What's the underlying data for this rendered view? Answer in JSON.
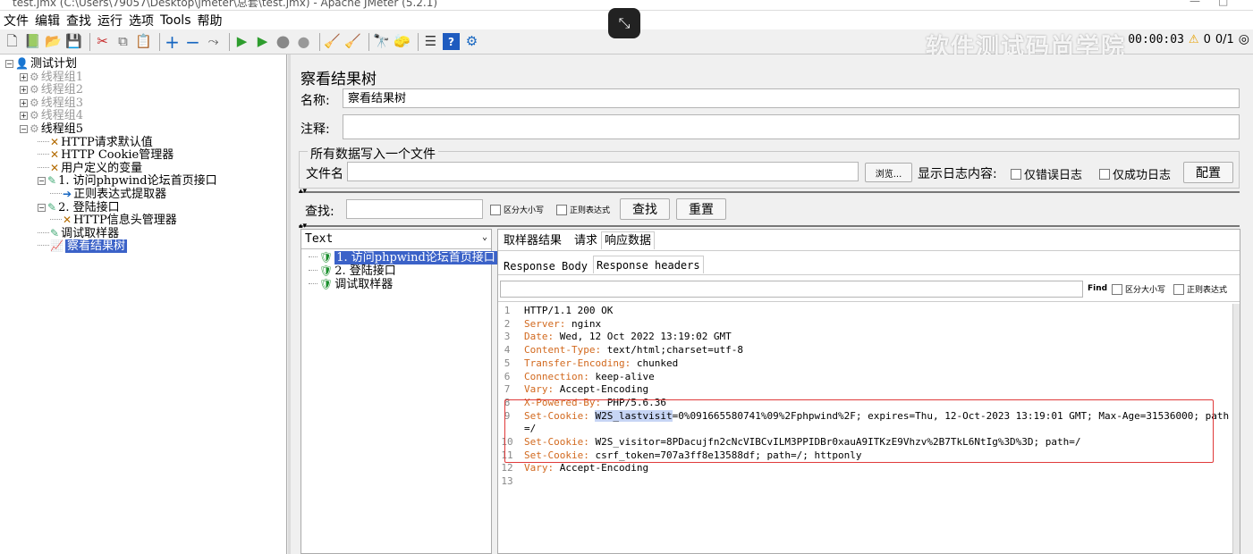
{
  "window": {
    "title": "test.jmx (C:\\Users\\79057\\Desktop\\jmeter\\总套\\test.jmx) - Apache JMeter (5.2.1)"
  },
  "menu": [
    "文件",
    "编辑",
    "查找",
    "运行",
    "选项",
    "Tools",
    "帮助"
  ],
  "toolbar": {
    "icons": [
      "new-icon",
      "templates-icon",
      "open-icon",
      "save-icon",
      "cut-icon",
      "copy-icon",
      "paste-icon",
      "expand-icon",
      "collapse-icon",
      "toggle-icon",
      "start-icon",
      "start-no-pause-icon",
      "stop-icon",
      "shutdown-icon",
      "clear-icon",
      "clear-all-icon",
      "search-icon",
      "reset-search-icon",
      "function-helper-icon",
      "help-icon",
      "remote-icon"
    ],
    "timer": "00:00:03",
    "warning_count": "0",
    "threads": "0/1"
  },
  "watermark": "软件测试码尚学院",
  "tree": [
    {
      "label": "测试计划",
      "level": 0,
      "icon": "test-plan-icon",
      "expand": "⊟"
    },
    {
      "label": "线程组1",
      "level": 1,
      "icon": "thread-group-icon",
      "expand": "⊞",
      "disabled": true
    },
    {
      "label": "线程组2",
      "level": 1,
      "icon": "thread-group-icon",
      "expand": "⊞",
      "disabled": true
    },
    {
      "label": "线程组3",
      "level": 1,
      "icon": "thread-group-icon",
      "expand": "⊞",
      "disabled": true
    },
    {
      "label": "线程组4",
      "level": 1,
      "icon": "thread-group-icon",
      "expand": "⊞",
      "disabled": true
    },
    {
      "label": "线程组5",
      "level": 1,
      "icon": "thread-group-icon",
      "expand": "⊟"
    },
    {
      "label": "HTTP请求默认值",
      "level": 2,
      "icon": "config-icon"
    },
    {
      "label": "HTTP Cookie管理器",
      "level": 2,
      "icon": "config-icon"
    },
    {
      "label": "用户定义的变量",
      "level": 2,
      "icon": "config-icon"
    },
    {
      "label": "1. 访问phpwind论坛首页接口",
      "level": 2,
      "icon": "sampler-icon",
      "expand": "⊟"
    },
    {
      "label": "正则表达式提取器",
      "level": 3,
      "icon": "extractor-icon"
    },
    {
      "label": "2. 登陆接口",
      "level": 2,
      "icon": "sampler-icon",
      "expand": "⊟"
    },
    {
      "label": "HTTP信息头管理器",
      "level": 3,
      "icon": "config-icon"
    },
    {
      "label": "调试取样器",
      "level": 2,
      "icon": "sampler-icon"
    },
    {
      "label": "察看结果树",
      "level": 2,
      "icon": "listener-icon",
      "selected": true
    }
  ],
  "panel": {
    "title": "察看结果树",
    "name_label": "名称:",
    "name_value": "察看结果树",
    "comment_label": "注释:",
    "comment_value": "",
    "file_group": "所有数据写入一个文件",
    "filename_label": "文件名",
    "browse": "浏览...",
    "log_label": "显示日志内容:",
    "errors_only": "仅错误日志",
    "success_only": "仅成功日志",
    "configure": "配置"
  },
  "search": {
    "label": "查找:",
    "case": "区分大小写",
    "regex": "正则表达式",
    "find": "查找",
    "reset": "重置"
  },
  "results": {
    "renderer": "Text",
    "items": [
      {
        "label": "1. 访问phpwind论坛首页接口",
        "selected": true
      },
      {
        "label": "2. 登陆接口",
        "selected": false
      },
      {
        "label": "调试取样器",
        "selected": false
      }
    ]
  },
  "detail": {
    "tabs": [
      "取样器结果",
      "请求",
      "响应数据"
    ],
    "subtabs": [
      "Response Body",
      "Response headers"
    ],
    "find_label": "Find",
    "find_case": "区分大小写",
    "find_regex": "正则表达式"
  },
  "headers": [
    {
      "n": "1",
      "k": "HTTP/1.1",
      "v": " 200 OK"
    },
    {
      "n": "2",
      "k": "Server:",
      "v": " nginx"
    },
    {
      "n": "3",
      "k": "Date:",
      "v": " Wed, 12 Oct 2022 13:19:02 GMT"
    },
    {
      "n": "4",
      "k": "Content-Type:",
      "v": " text/html;charset=utf-8"
    },
    {
      "n": "5",
      "k": "Transfer-Encoding:",
      "v": " chunked"
    },
    {
      "n": "6",
      "k": "Connection:",
      "v": " keep-alive"
    },
    {
      "n": "7",
      "k": "Vary:",
      "v": " Accept-Encoding"
    },
    {
      "n": "8",
      "k": "X-Powered-By:",
      "v": " PHP/5.6.36"
    },
    {
      "n": "9",
      "k": "Set-Cookie:",
      "hl": "W2S_lastvisit",
      "v": "=0%091665580741%09%2Fphpwind%2F; expires=Thu, 12-Oct-2023 13:19:01 GMT; Max-Age=31536000; path"
    },
    {
      "n": "",
      "k": "",
      "v": "=/"
    },
    {
      "n": "10",
      "k": "Set-Cookie:",
      "v": " W2S_visitor=8PDacujfn2cNcVIBCvILM3PPIDBr0xauA9ITKzE9Vhzv%2B7TkL6NtIg%3D%3D; path=/"
    },
    {
      "n": "11",
      "k": "Set-Cookie:",
      "v": " csrf_token=707a3ff8e13588df; path=/; httponly"
    },
    {
      "n": "12",
      "k": "Vary:",
      "v": " Accept-Encoding"
    },
    {
      "n": "13",
      "k": "",
      "v": ""
    }
  ]
}
